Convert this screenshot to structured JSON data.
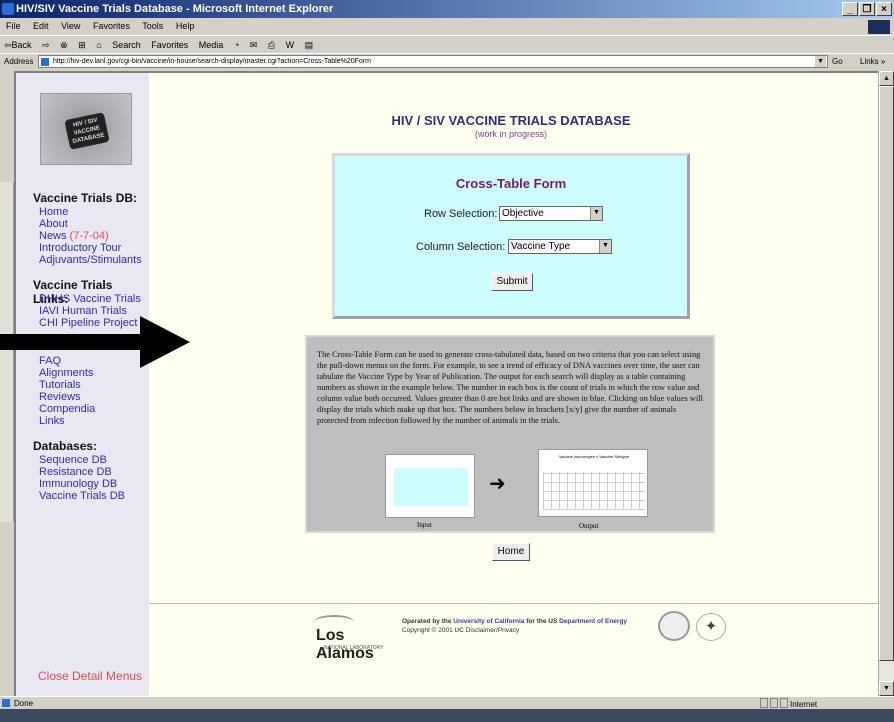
{
  "window": {
    "title": "HIV/SIV Vaccine Trials Database - Microsoft Internet Explorer",
    "controls": [
      "_",
      "❐",
      "×"
    ]
  },
  "menu": {
    "items": [
      "File",
      "Edit",
      "View",
      "Favorites",
      "Tools",
      "Help"
    ]
  },
  "toolbar": {
    "items": [
      "⇦Back",
      "⇨",
      "⊗",
      "⊞",
      "⌂",
      "Search",
      "Favorites",
      "Media",
      "◔",
      "✉",
      "⎙",
      "W",
      "▤"
    ]
  },
  "address": {
    "label": "Address",
    "url": "http://hiv-dev.lanl.gov/cgi-bin/vaccine/in-house/search-display/master.cgi?action=Cross-Table%20Form",
    "go": "Go",
    "links": "Links »"
  },
  "sidebar": {
    "logo_text": "HIV / SIV VACCINE DATABASE",
    "sections": [
      {
        "heading": "Vaccine Trials DB:",
        "links": [
          "Home",
          "About",
          "News",
          "Introductory Tour",
          "Adjuvants/Stimulants"
        ],
        "news_date": "(7-7-04)"
      },
      {
        "heading": "Vaccine Trials Links:",
        "links": [
          "DHHS Vaccine Trials",
          "IAVI Human Trials",
          "CHI Pipeline Project"
        ]
      },
      {
        "heading": "",
        "links": [
          "FAQ",
          "Alignments",
          "Tutorials",
          "Reviews",
          "Compendia",
          "Links"
        ]
      },
      {
        "heading": "Databases:",
        "links": [
          "Sequence DB",
          "Resistance DB",
          "Immunology DB",
          "Vaccine Trials DB"
        ]
      }
    ],
    "close_menus": "Close Detail Menus"
  },
  "main": {
    "title": "HIV / SIV VACCINE TRIALS DATABASE",
    "subtitle": "(work in progress)",
    "form": {
      "title": "Cross-Table Form",
      "row_label": "Row Selection:",
      "row_value": "Objective",
      "col_label": "Column Selection:",
      "col_value": "Vaccine Type",
      "submit": "Submit"
    },
    "description": "The Cross-Table Form can be used to generate cross-tabulated data, based on two criteria that you can select using the pull-down menus on the form. For example, to see a trend of efficacy of DNA vaccines over time, the user can tabulate the Vaccine Type by Year of Publication. The output for each search will display as a table containing numbers as shown in the example below. The number in each box is the count of trials in which the row value and column value both occurred. Values greater than 0 are hot links and are shown in blue. Clicking on blue values will display the trials which make up that box. The numbers below in brackets [x/y] give the number of animals protected from infection followed by the number of animals in the trials.",
    "example": {
      "input_caption": "Input",
      "output_caption": "Output",
      "output_title": "Vaccine Immunogen x Vaccine Subtype"
    },
    "home_button": "Home"
  },
  "footer": {
    "lanl_word": "Los Alamos",
    "lanl_sub": "NATIONAL LABORATORY",
    "op_prefix": "Operated by the ",
    "op_org1": "University of California",
    "op_mid": " for the US ",
    "op_org2": "Department of Energy",
    "copyright": "Copyright © 2001 UC Disclaimer/Privacy"
  },
  "status": {
    "text": "Done",
    "zone": "Internet"
  },
  "colors": {
    "link": "#2d2db0",
    "news_date": "#e05050",
    "form_bg": "#ccfcfc",
    "form_title": "#7a1a6a",
    "page_title": "#30307a"
  }
}
